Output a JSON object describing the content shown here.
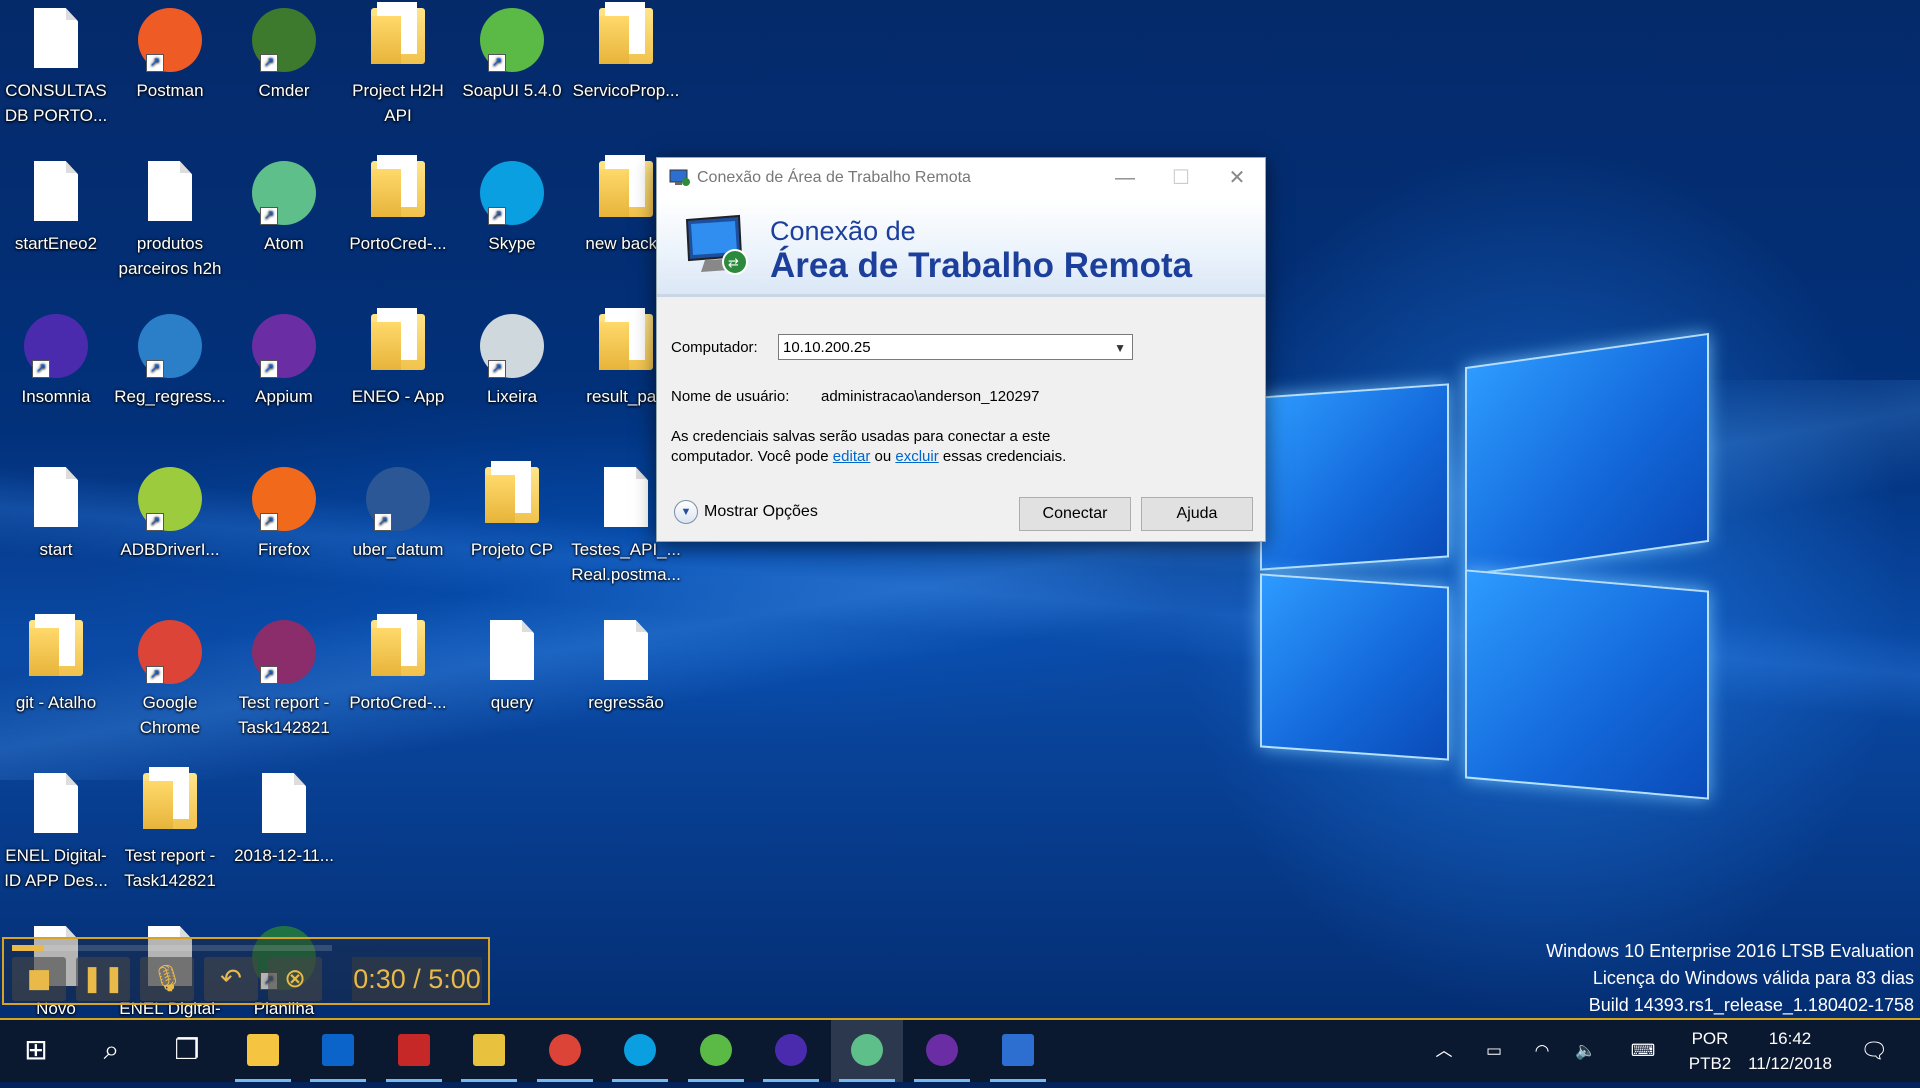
{
  "desktop": {
    "icons": [
      {
        "label": "CONSULTAS DB PORTO...",
        "kind": "doc"
      },
      {
        "label": "Postman",
        "kind": "app",
        "color": "#ef5b25"
      },
      {
        "label": "Cmder",
        "kind": "app",
        "color": "#3d7a2e"
      },
      {
        "label": "Project H2H API",
        "kind": "folder"
      },
      {
        "label": "SoapUI 5.4.0",
        "kind": "app",
        "color": "#5bb946"
      },
      {
        "label": "ServicoProp...",
        "kind": "folder"
      },
      {
        "label": "startEneo2",
        "kind": "doc"
      },
      {
        "label": "produtos parceiros h2h",
        "kind": "doc"
      },
      {
        "label": "Atom",
        "kind": "app",
        "color": "#5fbf8a"
      },
      {
        "label": "PortoCred-...",
        "kind": "folder"
      },
      {
        "label": "Skype",
        "kind": "app",
        "color": "#0a9fe0"
      },
      {
        "label": "new backu",
        "kind": "folder"
      },
      {
        "label": "Insomnia",
        "kind": "app",
        "color": "#4b2bad"
      },
      {
        "label": "Reg_regress...",
        "kind": "app",
        "color": "#2a7fc8"
      },
      {
        "label": "Appium",
        "kind": "app",
        "color": "#6b2da3"
      },
      {
        "label": "ENEO - App",
        "kind": "folder"
      },
      {
        "label": "Lixeira",
        "kind": "app",
        "color": "#cfd8dc"
      },
      {
        "label": "result_paq",
        "kind": "folder"
      },
      {
        "label": "start",
        "kind": "doc"
      },
      {
        "label": "ADBDriverI...",
        "kind": "app",
        "color": "#9ccc3d"
      },
      {
        "label": "Firefox",
        "kind": "app",
        "color": "#f16a1b"
      },
      {
        "label": "uber_datum",
        "kind": "app",
        "color": "#2b5797"
      },
      {
        "label": "Projeto CP",
        "kind": "folder"
      },
      {
        "label": "Testes_API_... Real.postma...",
        "kind": "doc"
      },
      {
        "label": "git - Atalho",
        "kind": "folder"
      },
      {
        "label": "Google Chrome",
        "kind": "app",
        "color": "#db4437"
      },
      {
        "label": "Test report - Task142821",
        "kind": "app",
        "color": "#8a2d6a"
      },
      {
        "label": "PortoCred-...",
        "kind": "folder"
      },
      {
        "label": "query",
        "kind": "doc"
      },
      {
        "label": "regressão",
        "kind": "doc"
      },
      {
        "label": "ENEL Digital- ID APP Des...",
        "kind": "doc"
      },
      {
        "label": "Test report - Task142821",
        "kind": "folder"
      },
      {
        "label": "2018-12-11...",
        "kind": "doc"
      },
      {
        "label": "Novo",
        "kind": "doc"
      },
      {
        "label": "ENEL Digital-",
        "kind": "doc"
      },
      {
        "label": "Planilha",
        "kind": "app",
        "color": "#1f7244"
      }
    ]
  },
  "dialog": {
    "title": "Conexão de Área de Trabalho Remota",
    "banner_line1": "Conexão de",
    "banner_line2": "Área de Trabalho Remota",
    "computer_label": "Computador:",
    "computer_value": "10.10.200.25",
    "username_label": "Nome de usuário:",
    "username_value": "administracao\\anderson_120297",
    "info_part1": "As credenciais salvas serão usadas para conectar a este",
    "info_part2": "computador. Você pode",
    "info_edit": "editar",
    "info_or": "ou",
    "info_delete": "excluir",
    "info_end": "essas credenciais.",
    "show_options": "Mostrar Opções",
    "connect_button": "Conectar",
    "help_button": "Ajuda"
  },
  "recorder": {
    "time": "0:30 / 5:00",
    "progress": 0.1
  },
  "watermark": {
    "line1": "Windows 10 Enterprise 2016 LTSB Evaluation",
    "line2": "Licença do Windows válida para 83 dias",
    "line3": "Build 14393.rs1_release_1.180402-1758"
  },
  "taskbar": {
    "apps": [
      "start-icon",
      "search-icon",
      "task-view-icon",
      "file-explorer-icon",
      "outlook-icon",
      "security-icon",
      "installer-icon",
      "chrome-icon",
      "skype-icon",
      "soapui-icon",
      "insomnia-icon",
      "atom-icon",
      "appium-icon",
      "remote-desktop-icon"
    ],
    "language_line1": "POR",
    "language_line2": "PTB2",
    "time": "16:42",
    "date": "11/12/2018"
  }
}
